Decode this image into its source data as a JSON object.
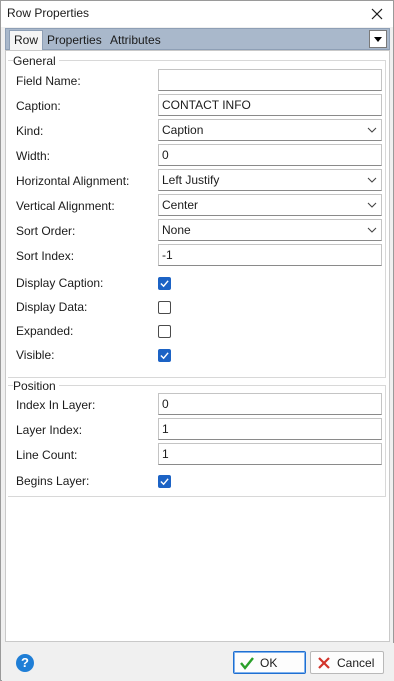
{
  "window": {
    "title": "Row Properties"
  },
  "tabs": [
    {
      "label": "Row"
    },
    {
      "label": "Properties"
    },
    {
      "label": "Attributes"
    }
  ],
  "general": {
    "label": "General",
    "field_name": {
      "label": "Field Name:",
      "value": ""
    },
    "caption": {
      "label": "Caption:",
      "value": "CONTACT INFO"
    },
    "kind": {
      "label": "Kind:",
      "value": "Caption"
    },
    "width": {
      "label": "Width:",
      "value": "0"
    },
    "horizontal_alignment": {
      "label": "Horizontal Alignment:",
      "value": "Left Justify"
    },
    "vertical_alignment": {
      "label": "Vertical Alignment:",
      "value": "Center"
    },
    "sort_order": {
      "label": "Sort Order:",
      "value": "None"
    },
    "sort_index": {
      "label": "Sort Index:",
      "value": "-1"
    },
    "display_caption": {
      "label": "Display Caption:",
      "checked": true
    },
    "display_data": {
      "label": "Display Data:",
      "checked": false
    },
    "expanded": {
      "label": "Expanded:",
      "checked": false
    },
    "visible": {
      "label": "Visible:",
      "checked": true
    }
  },
  "position": {
    "label": "Position",
    "index_in_layer": {
      "label": "Index In Layer:",
      "value": "0"
    },
    "layer_index": {
      "label": "Layer Index:",
      "value": "1"
    },
    "line_count": {
      "label": "Line Count:",
      "value": "1"
    },
    "begins_layer": {
      "label": "Begins Layer:",
      "checked": true
    }
  },
  "footer": {
    "help_icon": "help-icon",
    "ok_label": "OK",
    "cancel_label": "Cancel"
  },
  "colors": {
    "tab_strip": "#a9b8cb",
    "checkbox_checked": "#1c63c5",
    "ok_check": "#2aa02a",
    "cancel_x": "#d2342b"
  }
}
